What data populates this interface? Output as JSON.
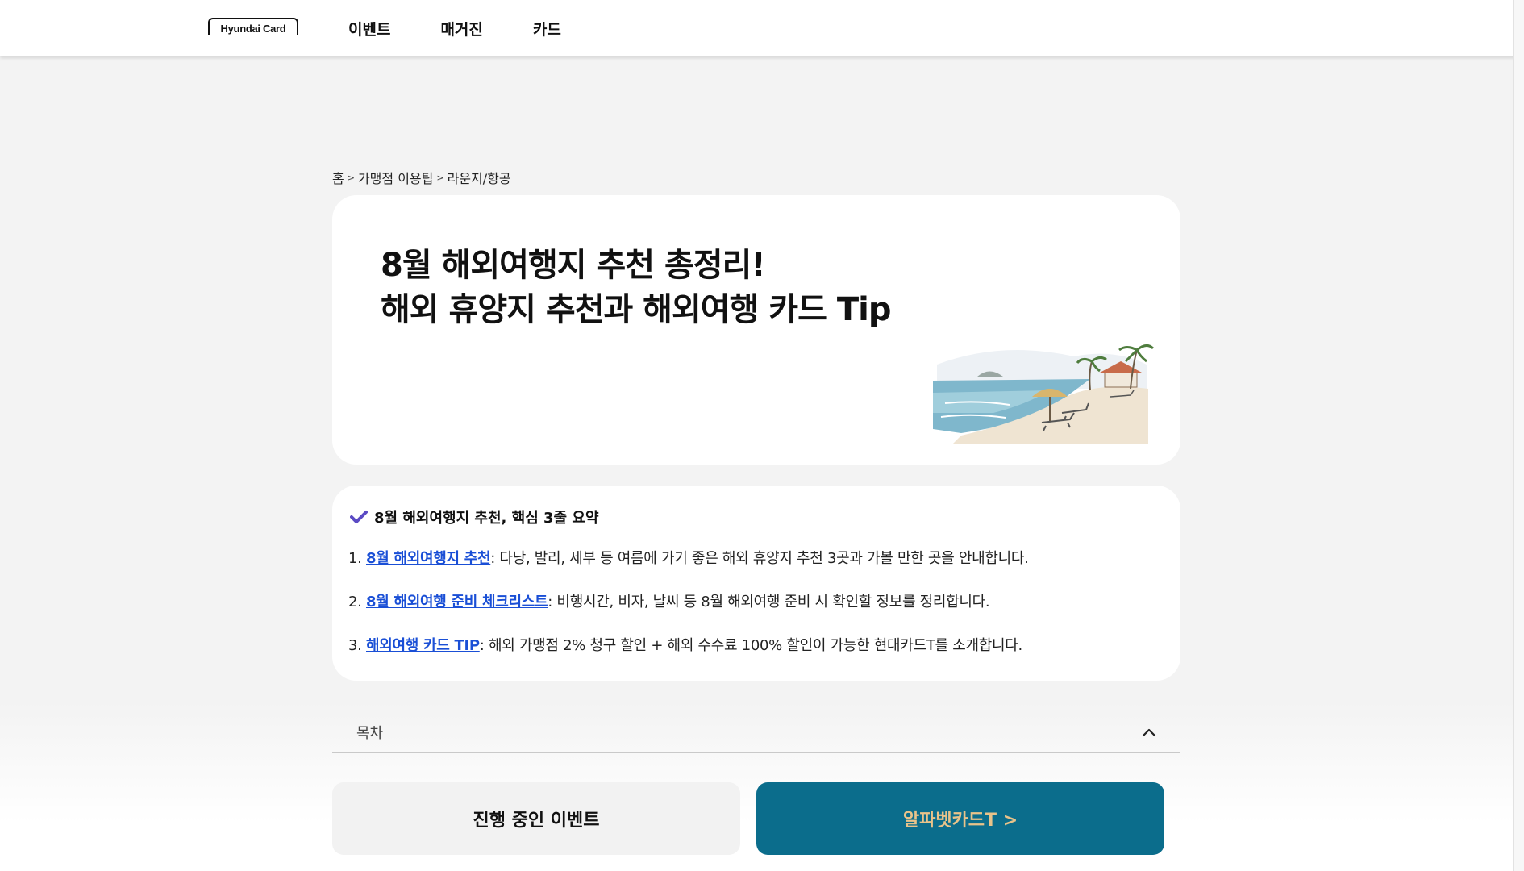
{
  "header": {
    "logo_text": "Hyundai Card",
    "nav": [
      {
        "label": "이벤트"
      },
      {
        "label": "매거진"
      },
      {
        "label": "카드"
      }
    ]
  },
  "breadcrumb": [
    "홈",
    "가맹점 이용팁",
    "라운지/항공"
  ],
  "hero": {
    "title_line1": "8월 해외여행지 추천 총정리!",
    "title_line2": "해외 휴양지 추천과 해외여행 카드 Tip",
    "illustration": "beach-illustration"
  },
  "summary": {
    "heading": "8월 해외여행지 추천, 핵심 3줄 요약",
    "items": [
      {
        "num": "1. ",
        "link": "8월 해외여행지 추천",
        "text": ": 다낭, 발리, 세부 등 여름에 가기 좋은 해외 휴양지 추천 3곳과 가볼 만한 곳을 안내합니다."
      },
      {
        "num": "2. ",
        "link": "8월 해외여행 준비 체크리스트",
        "text": ": 비행시간, 비자, 날씨 등 8월 해외여행 준비 시 확인할 정보를 정리합니다."
      },
      {
        "num": "3. ",
        "link": "해외여행 카드 TIP",
        "text": ": 해외 가맹점 2% 청구 할인 + 해외 수수료 100% 할인이 가능한 현대카드T를 소개합니다."
      }
    ]
  },
  "toc": {
    "label": "목차",
    "icon": "chevron-up-icon"
  },
  "buttons": {
    "events": "진행 중인 이벤트",
    "card": "알파벳카드T >"
  },
  "colors": {
    "link": "#1a4fd6",
    "card_button_bg": "#0b6d8c",
    "card_button_text": "#e9c38a",
    "check": "#5b4bc4"
  }
}
